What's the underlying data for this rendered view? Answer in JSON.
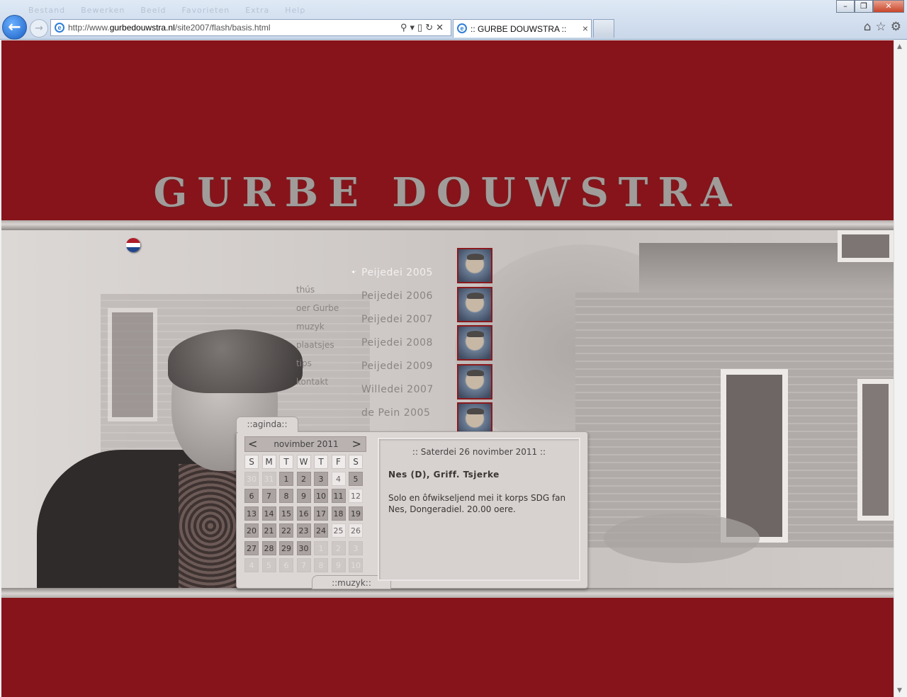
{
  "browser": {
    "menu_hint": [
      "Bestand",
      "Bewerken",
      "Beeld",
      "Favorieten",
      "Extra",
      "Help"
    ],
    "url_prefix": "http://www.",
    "url_domain": "gurbedouwstra.nl",
    "url_path": "/site2007/flash/basis.html",
    "tab_title": ":: GURBE DOUWSTRA ::",
    "back_icon": "back-arrow-icon",
    "forward_icon": "forward-arrow-icon"
  },
  "site": {
    "logo": "GURBE DOUWSTRA",
    "flag": {
      "colors": [
        "#ae1c28",
        "#ffffff",
        "#21468b"
      ]
    },
    "nav": [
      "thús",
      "oer Gurbe",
      "muzyk",
      "plaatsjes",
      "tips",
      "kontakt"
    ],
    "events": [
      {
        "label": "Peijedei 2005",
        "selected": true
      },
      {
        "label": "Peijedei 2006",
        "selected": false
      },
      {
        "label": "Peijedei 2007",
        "selected": false
      },
      {
        "label": "Peijedei 2008",
        "selected": false
      },
      {
        "label": "Peijedei 2009",
        "selected": false
      },
      {
        "label": "Willedei 2007",
        "selected": false
      },
      {
        "label": "de Pein 2005",
        "selected": false
      }
    ],
    "selected_marker": "◂·",
    "agenda_tab": "::aginda::",
    "muzyk_tab": "::muzyk::",
    "calendar": {
      "prev": "<",
      "next": ">",
      "month": "novimber 2011",
      "weekdays": [
        "S",
        "M",
        "T",
        "W",
        "T",
        "F",
        "S"
      ],
      "days": [
        {
          "d": "30",
          "t": "oth"
        },
        {
          "d": "31",
          "t": "oth"
        },
        {
          "d": "1",
          "t": "cur"
        },
        {
          "d": "2",
          "t": "cur"
        },
        {
          "d": "3",
          "t": "cur"
        },
        {
          "d": "4",
          "t": "ev"
        },
        {
          "d": "5",
          "t": "cur"
        },
        {
          "d": "6",
          "t": "cur"
        },
        {
          "d": "7",
          "t": "cur"
        },
        {
          "d": "8",
          "t": "cur"
        },
        {
          "d": "9",
          "t": "cur"
        },
        {
          "d": "10",
          "t": "cur"
        },
        {
          "d": "11",
          "t": "cur"
        },
        {
          "d": "12",
          "t": "ev"
        },
        {
          "d": "13",
          "t": "cur"
        },
        {
          "d": "14",
          "t": "cur"
        },
        {
          "d": "15",
          "t": "cur"
        },
        {
          "d": "16",
          "t": "cur"
        },
        {
          "d": "17",
          "t": "cur"
        },
        {
          "d": "18",
          "t": "cur"
        },
        {
          "d": "19",
          "t": "cur"
        },
        {
          "d": "20",
          "t": "cur"
        },
        {
          "d": "21",
          "t": "cur"
        },
        {
          "d": "22",
          "t": "cur"
        },
        {
          "d": "23",
          "t": "cur"
        },
        {
          "d": "24",
          "t": "cur"
        },
        {
          "d": "25",
          "t": "ev"
        },
        {
          "d": "26",
          "t": "ev"
        },
        {
          "d": "27",
          "t": "cur"
        },
        {
          "d": "28",
          "t": "cur"
        },
        {
          "d": "29",
          "t": "cur"
        },
        {
          "d": "30",
          "t": "cur"
        },
        {
          "d": "1",
          "t": "oth"
        },
        {
          "d": "2",
          "t": "oth"
        },
        {
          "d": "3",
          "t": "oth"
        },
        {
          "d": "4",
          "t": "oth"
        },
        {
          "d": "5",
          "t": "oth"
        },
        {
          "d": "6",
          "t": "oth"
        },
        {
          "d": "7",
          "t": "oth"
        },
        {
          "d": "8",
          "t": "oth"
        },
        {
          "d": "9",
          "t": "oth"
        },
        {
          "d": "10",
          "t": "oth"
        }
      ]
    },
    "detail": {
      "title": ":: Saterdei 26 novimber 2011 ::",
      "location": "Nes (D), Griff. Tsjerke",
      "description": "Solo en ôfwikseljend mei it korps SDG fan Nes, Dongeradiel. 20.00 oere."
    }
  }
}
